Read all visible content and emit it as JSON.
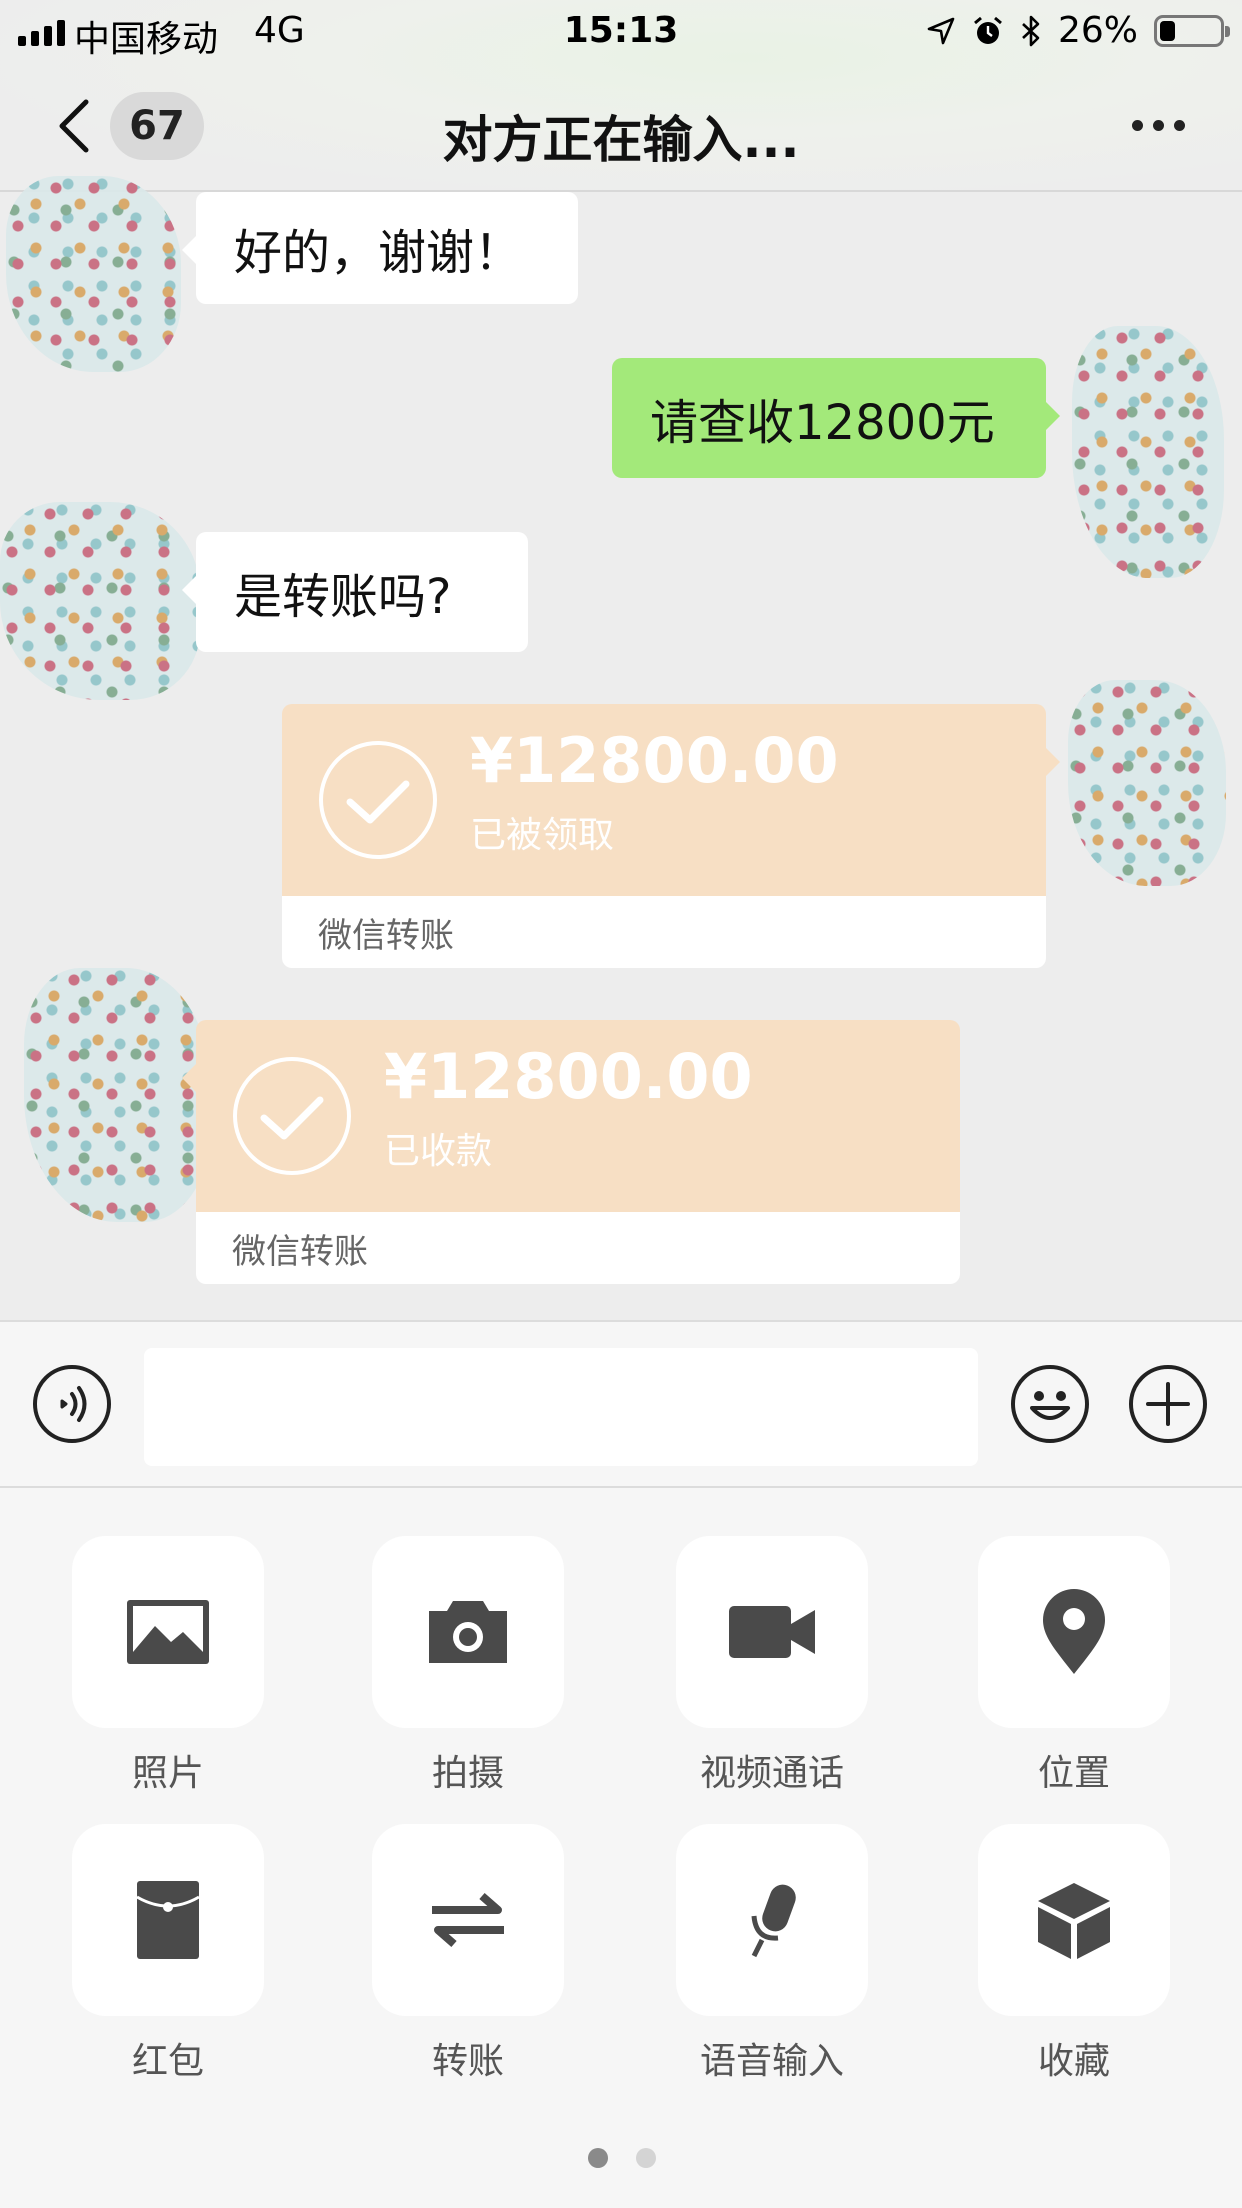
{
  "status_bar": {
    "carrier": "中国移动",
    "network": "4G",
    "time": "15:13",
    "battery_percent_label": "26%",
    "battery_level": 0.26
  },
  "nav": {
    "unread_count": "67",
    "title": "对方正在输入..."
  },
  "messages": [
    {
      "side": "in",
      "text": "好的，谢谢！"
    },
    {
      "side": "out",
      "text": "请查收12800元"
    },
    {
      "side": "in",
      "text": "是转账吗?"
    },
    {
      "side": "out",
      "type": "transfer",
      "amount": "¥12800.00",
      "status": "已被领取",
      "label": "微信转账"
    },
    {
      "side": "in",
      "type": "transfer",
      "amount": "¥12800.00",
      "status": "已收款",
      "label": "微信转账"
    }
  ],
  "panel": {
    "items": [
      {
        "label": "照片",
        "icon": "photo-icon"
      },
      {
        "label": "拍摄",
        "icon": "camera-icon"
      },
      {
        "label": "视频通话",
        "icon": "video-call-icon"
      },
      {
        "label": "位置",
        "icon": "location-icon"
      },
      {
        "label": "红包",
        "icon": "red-packet-icon"
      },
      {
        "label": "转账",
        "icon": "transfer-icon"
      },
      {
        "label": "语音输入",
        "icon": "microphone-icon"
      },
      {
        "label": "收藏",
        "icon": "favorites-icon"
      }
    ],
    "page_count": 2,
    "current_page": 1
  },
  "colors": {
    "incoming_bubble": "#ffffff",
    "outgoing_bubble": "#a3e97a",
    "transfer_card": "#f7dfc4",
    "background": "#ededed",
    "icon": "#4a4a4a"
  }
}
